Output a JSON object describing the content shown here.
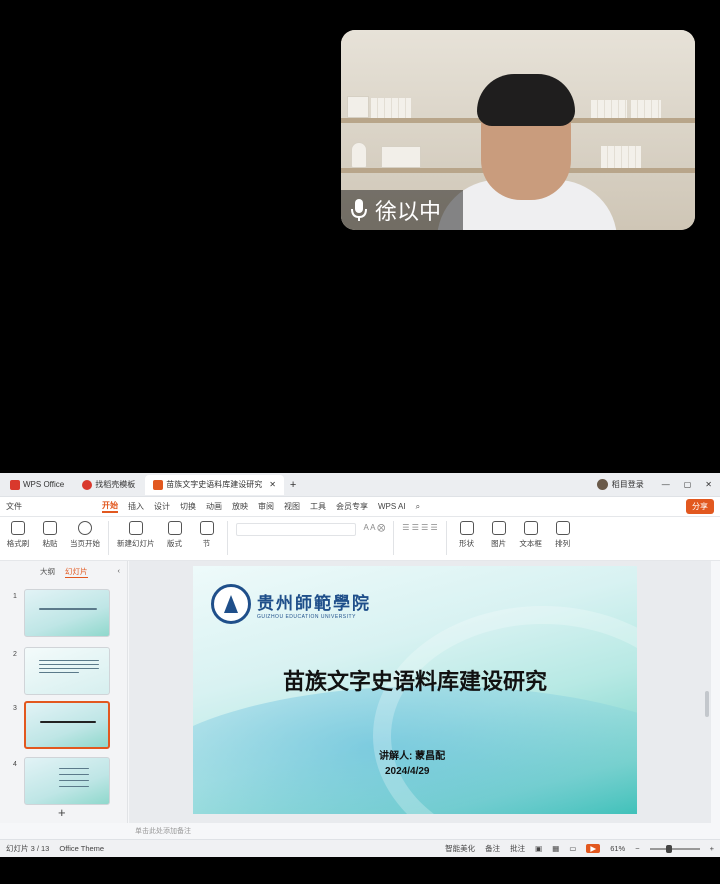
{
  "video": {
    "participant_name": "徐以中",
    "icon": "microphone-icon"
  },
  "wps": {
    "tabs": [
      {
        "label": "WPS Office",
        "icon": "wps-logo-icon",
        "color": "#d9382c"
      },
      {
        "label": "找稻壳模板",
        "icon": "docer-icon",
        "color": "#d9382c"
      },
      {
        "label": "苗族文字史语料库建设研究",
        "icon": "ppt-file-icon",
        "color": "#e2581f"
      }
    ],
    "user_label": "稻目登录",
    "menu": [
      "文件",
      "开始",
      "插入",
      "设计",
      "切换",
      "动画",
      "放映",
      "审阅",
      "视图",
      "工具",
      "会员专享",
      "WPS AI"
    ],
    "menu_active": "开始",
    "share_label": "分享",
    "ribbon": [
      "格式刷",
      "粘贴",
      "当页开始",
      "新建幻灯片",
      "版式",
      "节",
      "形状",
      "图片",
      "文本框",
      "排列"
    ],
    "panel_tabs": [
      "大纲",
      "幻灯片"
    ],
    "panel_active": "幻灯片",
    "slide_numbers": [
      "1",
      "2",
      "3",
      "4"
    ],
    "add_slide": "+",
    "slide": {
      "school_name": "贵州師範學院",
      "school_english": "GUIZHOU EDUCATION UNIVERSITY",
      "title": "苗族文字史语料库建设研究",
      "speaker": "讲解人: 蒙昌配",
      "date": "2024/4/29"
    },
    "notes_placeholder": "单击此处添加备注",
    "status": {
      "slide_count": "幻灯片 3 / 13",
      "theme": "Office Theme",
      "smart_beautify": "智能美化",
      "notes": "备注",
      "comments": "批注",
      "zoom": "61%"
    }
  }
}
